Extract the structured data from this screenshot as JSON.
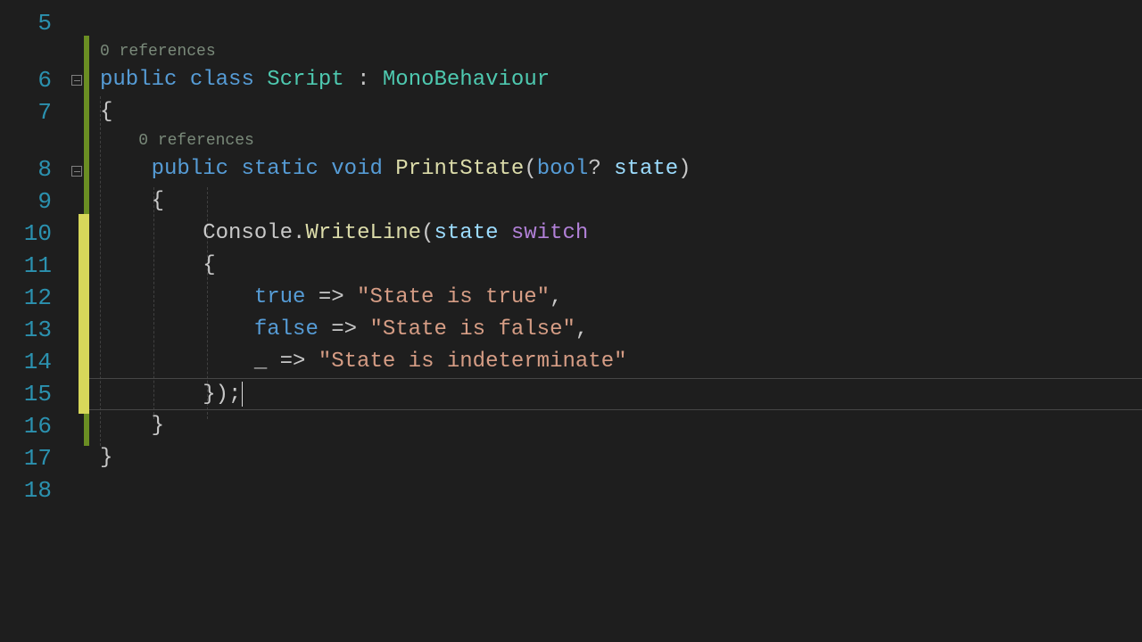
{
  "gutter": {
    "l5": "5",
    "l6": "6",
    "l7": "7",
    "l8": "8",
    "l9": "9",
    "l10": "10",
    "l11": "11",
    "l12": "12",
    "l13": "13",
    "l14": "14",
    "l15": "15",
    "l16": "16",
    "l17": "17",
    "l18": "18"
  },
  "codelens": {
    "refs_class": "0 references",
    "refs_method": "0 references"
  },
  "code": {
    "l6_public": "public",
    "l6_class": "class",
    "l6_name": "Script",
    "l6_colon": " : ",
    "l6_base": "MonoBehaviour",
    "l7": "{",
    "l8_public": "public",
    "l8_static": "static",
    "l8_void": "void",
    "l8_method": "PrintState",
    "l8_open": "(",
    "l8_bool": "bool",
    "l8_qmark": "?",
    "l8_param": "state",
    "l8_close": ")",
    "l9": "    {",
    "l10_ind": "        ",
    "l10_console": "Console",
    "l10_dot": ".",
    "l10_writeline": "WriteLine",
    "l10_open": "(",
    "l10_state": "state",
    "l10_switch": "switch",
    "l11": "        {",
    "l12_ind": "            ",
    "l12_true": "true",
    "l12_arrow": " => ",
    "l12_str": "\"State is true\"",
    "l12_comma": ",",
    "l13_ind": "            ",
    "l13_false": "false",
    "l13_arrow": " => ",
    "l13_str": "\"State is false\"",
    "l13_comma": ",",
    "l14_ind": "            ",
    "l14_disc": "_",
    "l14_arrow": " => ",
    "l14_str": "\"State is indeterminate\"",
    "l15": "        });",
    "l16": "    }",
    "l17": "}"
  }
}
